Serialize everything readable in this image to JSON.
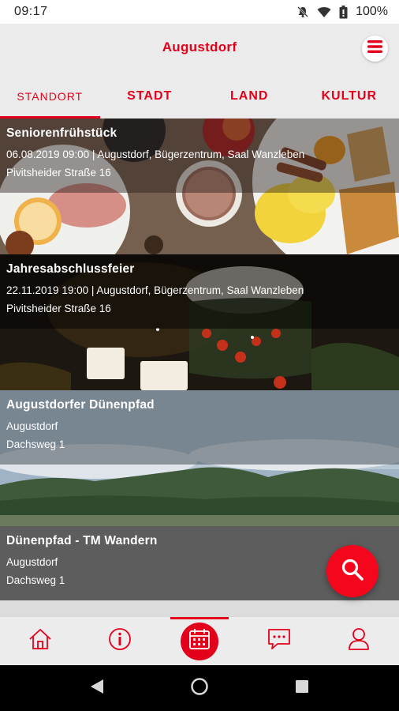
{
  "status_bar": {
    "time": "09:17",
    "battery": "100%"
  },
  "app_bar": {
    "title": "Augustdorf",
    "menu_icon": "hamburger-menu-icon"
  },
  "tabs": [
    {
      "label": "STANDORT",
      "active": true
    },
    {
      "label": "STADT",
      "active": false
    },
    {
      "label": "LAND",
      "active": false
    },
    {
      "label": "KULTUR",
      "active": false
    }
  ],
  "events": [
    {
      "name": "Seniorenfrühstück",
      "line1": "06.08.2019 09:00 | Augustdorf, Bügerzentrum, Saal Wanzleben",
      "line2": "Pivitsheider Straße 16"
    },
    {
      "name": "Jahresabschlussfeier",
      "line1": "22.11.2019 19:00 | Augustdorf, Bügerzentrum, Saal Wanzleben",
      "line2": "Pivitsheider Straße 16"
    },
    {
      "name": "Augustdorfer Dünenpfad",
      "line1": "Augustdorf",
      "line2": "Dachsweg 1"
    },
    {
      "name": "Dünenpfad - TM Wandern",
      "line1": "Augustdorf",
      "line2": "Dachsweg 1"
    }
  ],
  "fab": {
    "icon": "search-icon"
  },
  "bottom_nav": [
    {
      "icon": "home-icon",
      "active": false
    },
    {
      "icon": "info-icon",
      "active": false
    },
    {
      "icon": "calendar-icon",
      "active": true
    },
    {
      "icon": "chat-icon",
      "active": false
    },
    {
      "icon": "user-icon",
      "active": false
    }
  ],
  "colors": {
    "accent": "#e3001b",
    "background": "#ebebeb"
  }
}
